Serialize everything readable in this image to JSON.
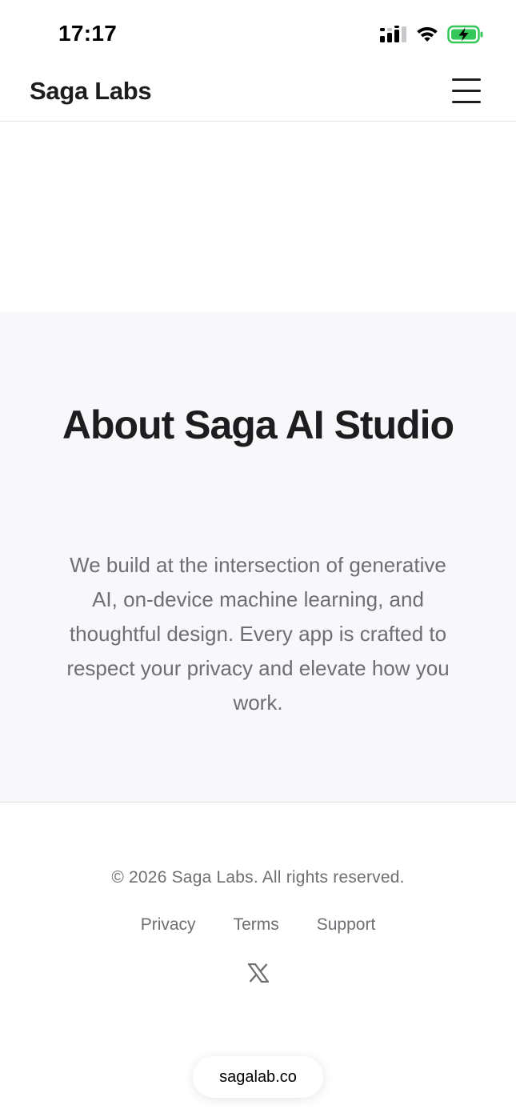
{
  "status_bar": {
    "time": "17:17",
    "battery_color": "#34c759"
  },
  "header": {
    "brand": "Saga Labs",
    "menu_icon": "hamburger-menu-icon"
  },
  "about": {
    "title": "About Saga AI Studio",
    "body": "We build at the intersection of generative AI, on-device machine learning, and thoughtful design. Every app is crafted to respect your privacy and elevate how you work."
  },
  "footer": {
    "copyright": "© 2026 Saga Labs. All rights reserved.",
    "links": [
      {
        "label": "Privacy"
      },
      {
        "label": "Terms"
      },
      {
        "label": "Support"
      }
    ],
    "social_icon": "x-logo-icon"
  },
  "browser": {
    "domain": "sagalab.co"
  }
}
